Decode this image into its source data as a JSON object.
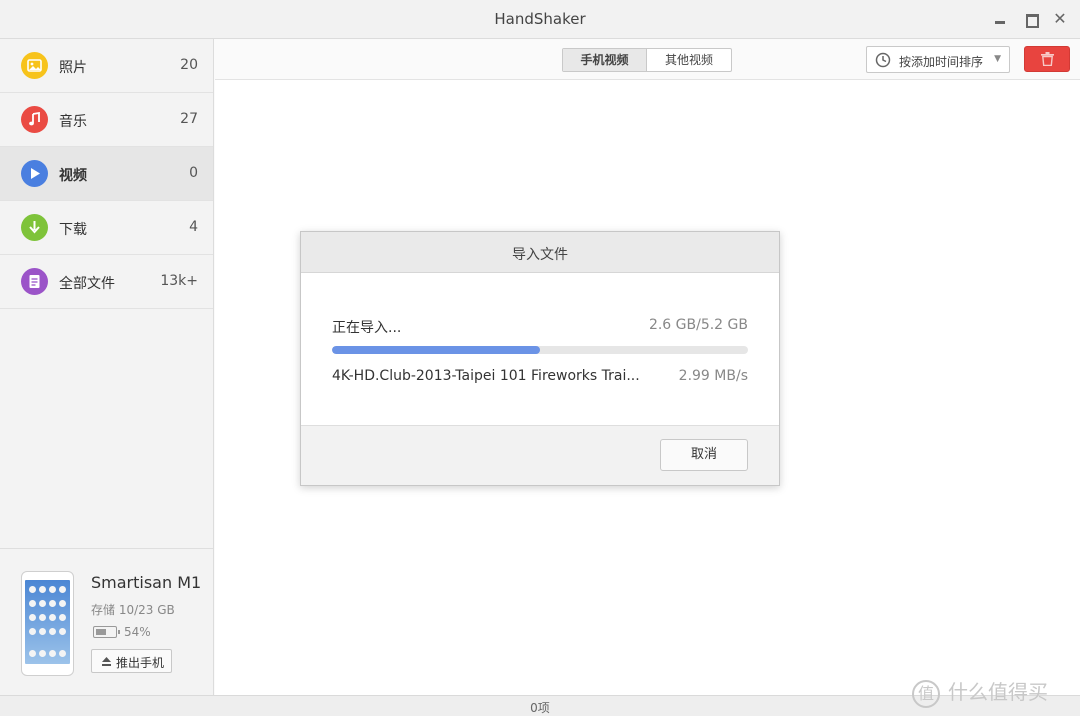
{
  "window": {
    "title": "HandShaker"
  },
  "sidebar": {
    "items": [
      {
        "label": "照片",
        "count": "20",
        "icon": "photo-icon",
        "color": "#f7c31b"
      },
      {
        "label": "音乐",
        "count": "27",
        "icon": "music-icon",
        "color": "#ea4b43"
      },
      {
        "label": "视频",
        "count": "0",
        "icon": "play-icon",
        "color": "#4a7fe0"
      },
      {
        "label": "下载",
        "count": "4",
        "icon": "download-icon",
        "color": "#7ec33a"
      },
      {
        "label": "全部文件",
        "count": "13k+",
        "icon": "document-icon",
        "color": "#9b54c8"
      }
    ],
    "active_index": 2
  },
  "device": {
    "name": "Smartisan M1",
    "storage": "存储 10/23 GB",
    "battery": "54%",
    "eject_label": "推出手机"
  },
  "toolbar": {
    "tabs": [
      "手机视频",
      "其他视频"
    ],
    "active_tab": 0,
    "sort_label": "按添加时间排序",
    "delete_color": "#e8443f"
  },
  "dialog": {
    "title": "导入文件",
    "status": "正在导入...",
    "size": "2.6 GB/5.2 GB",
    "progress": 0.5,
    "file": "4K-HD.Club-2013-Taipei 101 Fireworks Trai...",
    "speed": "2.99 MB/s",
    "cancel_label": "取消"
  },
  "statusbar": {
    "text": "0项"
  },
  "watermark": {
    "glyph": "值",
    "text": "什么值得买"
  }
}
